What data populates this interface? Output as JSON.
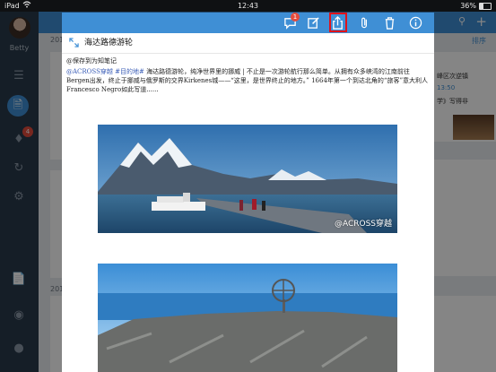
{
  "status_bar": {
    "carrier": "iPad",
    "time": "12:43",
    "battery": "36%"
  },
  "sidebar": {
    "user_name": "Betty",
    "notification_count": "4",
    "icons": [
      "menu-icon",
      "note-icon",
      "bell-icon",
      "sync-icon",
      "settings-icon",
      "new-doc-icon",
      "camera-icon",
      "microphone-icon"
    ]
  },
  "background": {
    "sort_label": "排序",
    "year_1": "201",
    "year_2": "201",
    "card_snippets": [
      "峰区次逆镇",
      "13:50",
      "学》写得非"
    ]
  },
  "toolbar": {
    "comment_badge": "1",
    "icons": [
      "comment-icon",
      "edit-icon",
      "share-icon",
      "attachment-icon",
      "trash-icon",
      "info-icon"
    ],
    "highlight_color": "#e0121a"
  },
  "note": {
    "title": "海达路德游轮",
    "saved_line": "@保存到为知笔记",
    "link_1": "@ACROSS穿越",
    "link_2": "#目的地#",
    "para_text": " 海达路德游轮，纯净世界里的挪威 | 不止是一次游轮航行那么简单。从拥有众多峡湾的江南前往Bergen出发，终止于挪威与俄罗斯的交界Kirkenes城——“这里，是世界终止的地方。” 1664年第一个到达北角的“旅客”意大利人Francesco Negro如此写道......",
    "watermark": "@ACROSS穿越"
  },
  "colors": {
    "accent": "#3f8fd5",
    "sidebar_bg": "#2a3a4b",
    "badge": "#e54b3c"
  }
}
